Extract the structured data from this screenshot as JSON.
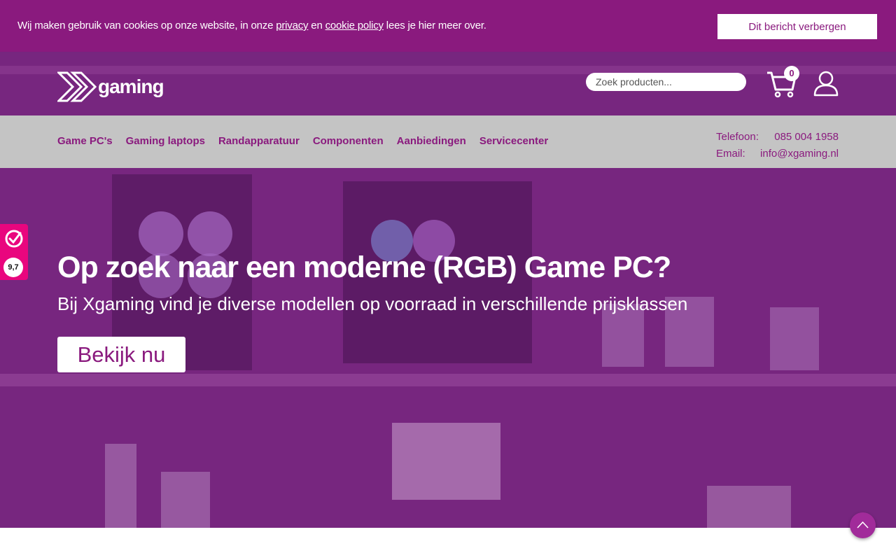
{
  "cookie": {
    "text_before": "Wij maken gebruik van cookies op onze website, in onze ",
    "privacy_link": "privacy",
    "text_middle": " en ",
    "cookie_link": "cookie policy",
    "text_after": " lees je hier meer over.",
    "hide_button": "Dit bericht verbergen"
  },
  "header": {
    "logo_text": "gaming",
    "search_placeholder": "Zoek producten...",
    "cart_count": "0"
  },
  "nav": {
    "items": [
      "Game PC's",
      "Gaming laptops",
      "Randapparatuur",
      "Componenten",
      "Aanbiedingen",
      "Servicecenter"
    ],
    "contact": {
      "phone_label": "Telefoon:",
      "phone": "085 004 1958",
      "email_label": "Email:",
      "email": "info@xgaming.nl"
    }
  },
  "rating": {
    "score": "9,7"
  },
  "hero": {
    "title": "Op zoek naar een moderne (RGB) Game PC?",
    "subtitle": "Bij Xgaming vind je diverse modellen op voorraad in verschillende prijsklassen",
    "button": "Bekijk nu"
  },
  "colors": {
    "brand": "#8a1a7e",
    "nav_bg": "#c4c4c4",
    "rating": "#e9067e"
  }
}
